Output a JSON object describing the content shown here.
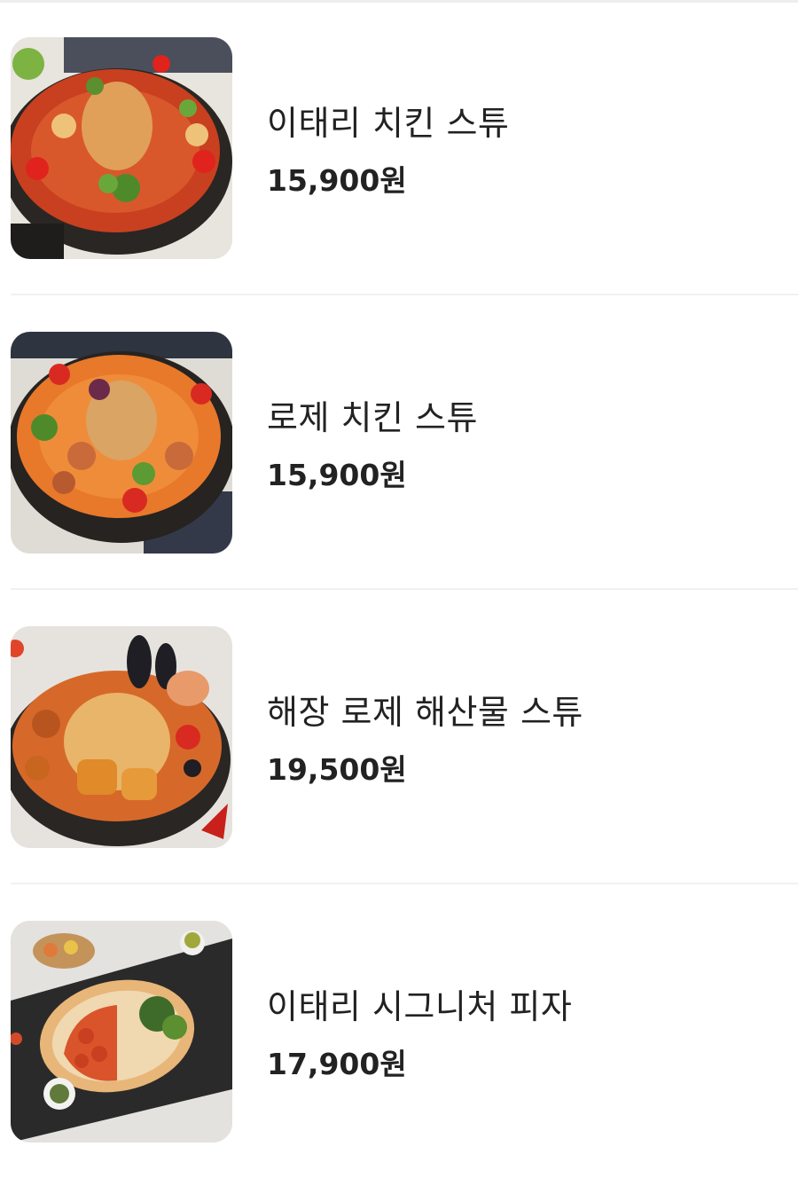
{
  "menu": {
    "items": [
      {
        "name": "이태리 치킨 스튜",
        "price": "15,900원",
        "image_icon": "italian-chicken-stew-photo"
      },
      {
        "name": "로제 치킨 스튜",
        "price": "15,900원",
        "image_icon": "rose-chicken-stew-photo"
      },
      {
        "name": "해장 로제 해산물 스튜",
        "price": "19,500원",
        "image_icon": "haejang-rose-seafood-stew-photo"
      },
      {
        "name": "이태리 시그니처 피자",
        "price": "17,900원",
        "image_icon": "italian-signature-pizza-photo"
      }
    ]
  },
  "colors": {
    "text": "#222222",
    "divider": "#f1f1f1",
    "background": "#ffffff"
  }
}
